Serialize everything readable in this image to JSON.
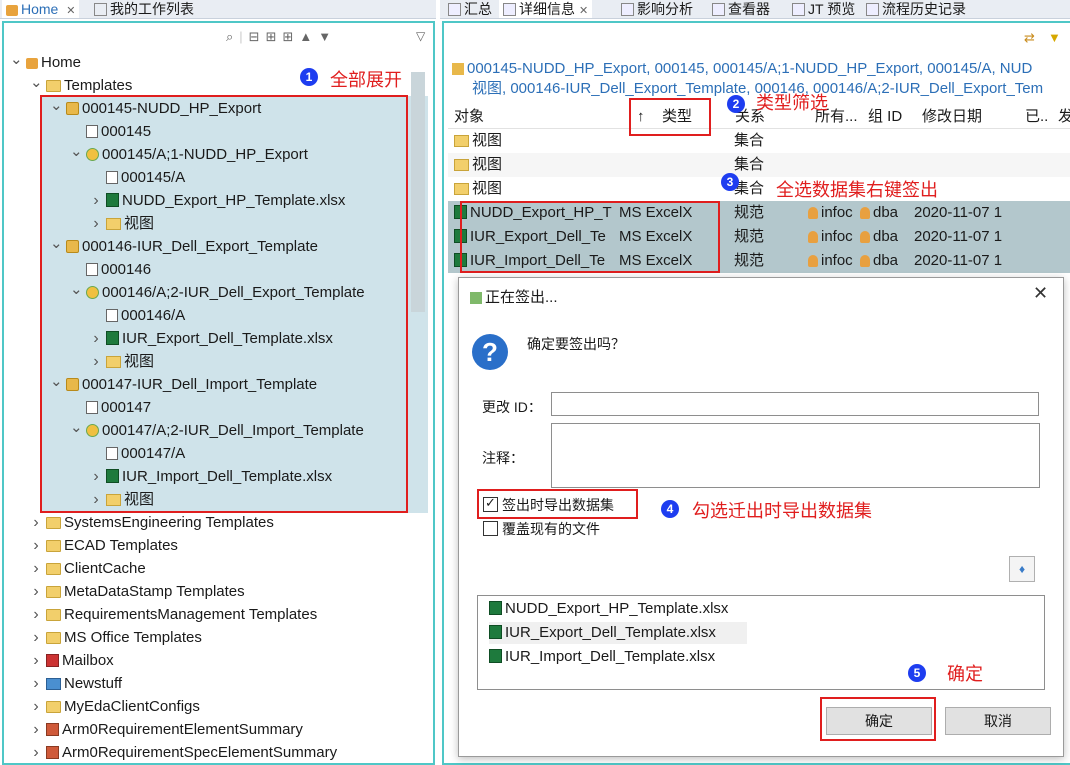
{
  "left_tabs": [
    "Home",
    "我的工作列表"
  ],
  "right_tabs": [
    "汇总",
    "详细信息",
    "影响分析",
    "查看器",
    "JT 预览",
    "流程历史记录"
  ],
  "tree": [
    {
      "label": "Home",
      "level": 0,
      "toggle": "v",
      "icon": "home-icon"
    },
    {
      "label": "Templates",
      "level": 1,
      "toggle": "v",
      "icon": "folder-icon"
    },
    {
      "label": "000145-NUDD_HP_Export",
      "level": 2,
      "toggle": "v",
      "icon": "item-icon"
    },
    {
      "label": "000145",
      "level": 3,
      "toggle": "",
      "icon": "form-icon"
    },
    {
      "label": "000145/A;1-NUDD_HP_Export",
      "level": 3,
      "toggle": "v",
      "icon": "revision-icon"
    },
    {
      "label": "000145/A",
      "level": 4,
      "toggle": "",
      "icon": "form-icon"
    },
    {
      "label": "NUDD_Export_HP_Template.xlsx",
      "level": 4,
      "toggle": ">",
      "icon": "excel-icon"
    },
    {
      "label": "视图",
      "level": 4,
      "toggle": ">",
      "icon": "view-folder-icon"
    },
    {
      "label": "000146-IUR_Dell_Export_Template",
      "level": 2,
      "toggle": "v",
      "icon": "item-icon"
    },
    {
      "label": "000146",
      "level": 3,
      "toggle": "",
      "icon": "form-icon"
    },
    {
      "label": "000146/A;2-IUR_Dell_Export_Template",
      "level": 3,
      "toggle": "v",
      "icon": "revision-icon"
    },
    {
      "label": "000146/A",
      "level": 4,
      "toggle": "",
      "icon": "form-icon"
    },
    {
      "label": "IUR_Export_Dell_Template.xlsx",
      "level": 4,
      "toggle": ">",
      "icon": "excel-icon"
    },
    {
      "label": "视图",
      "level": 4,
      "toggle": ">",
      "icon": "view-folder-icon"
    },
    {
      "label": "000147-IUR_Dell_Import_Template",
      "level": 2,
      "toggle": "v",
      "icon": "item-icon"
    },
    {
      "label": "000147",
      "level": 3,
      "toggle": "",
      "icon": "form-icon"
    },
    {
      "label": "000147/A;2-IUR_Dell_Import_Template",
      "level": 3,
      "toggle": "v",
      "icon": "revision-icon"
    },
    {
      "label": "000147/A",
      "level": 4,
      "toggle": "",
      "icon": "form-icon"
    },
    {
      "label": "IUR_Import_Dell_Template.xlsx",
      "level": 4,
      "toggle": ">",
      "icon": "excel-icon"
    },
    {
      "label": "视图",
      "level": 4,
      "toggle": ">",
      "icon": "view-folder-icon"
    },
    {
      "label": "SystemsEngineering Templates",
      "level": 1,
      "toggle": ">",
      "icon": "folder-icon"
    },
    {
      "label": "ECAD Templates",
      "level": 1,
      "toggle": ">",
      "icon": "folder-icon"
    },
    {
      "label": "ClientCache",
      "level": 1,
      "toggle": ">",
      "icon": "folder-icon"
    },
    {
      "label": "MetaDataStamp Templates",
      "level": 1,
      "toggle": ">",
      "icon": "folder-icon"
    },
    {
      "label": "RequirementsManagement Templates",
      "level": 1,
      "toggle": ">",
      "icon": "folder-icon"
    },
    {
      "label": "MS Office Templates",
      "level": 1,
      "toggle": ">",
      "icon": "folder-icon"
    },
    {
      "label": "Mailbox",
      "level": 1,
      "toggle": ">",
      "icon": "mailbox-icon"
    },
    {
      "label": "Newstuff",
      "level": 1,
      "toggle": ">",
      "icon": "newstuff-icon"
    },
    {
      "label": "MyEdaClientConfigs",
      "level": 1,
      "toggle": ">",
      "icon": "folder-icon"
    },
    {
      "label": "Arm0RequirementElementSummary",
      "level": 1,
      "toggle": ">",
      "icon": "table-icon"
    },
    {
      "label": "Arm0RequirementSpecElementSummary",
      "level": 1,
      "toggle": ">",
      "icon": "table-icon"
    }
  ],
  "details": {
    "path_line1": "000145-NUDD_HP_Export, 000145, 000145/A;1-NUDD_HP_Export, 000145/A, NUD",
    "path_line2": "视图, 000146-IUR_Dell_Export_Template, 000146, 000146/A;2-IUR_Dell_Export_Tem",
    "columns": [
      "对象",
      "类型",
      "关系",
      "所有...",
      "组 ID",
      "修改日期",
      "已..",
      "发"
    ],
    "rows": [
      {
        "object": "视图",
        "type": "",
        "relation": "集合",
        "owner": "",
        "group": "",
        "date": "",
        "icon": "view-folder-icon",
        "selected": false
      },
      {
        "object": "视图",
        "type": "",
        "relation": "集合",
        "owner": "",
        "group": "",
        "date": "",
        "icon": "view-folder-icon",
        "selected": false
      },
      {
        "object": "视图",
        "type": "",
        "relation": "集合",
        "owner": "",
        "group": "",
        "date": "",
        "icon": "view-folder-icon",
        "selected": false
      },
      {
        "object": "NUDD_Export_HP_T",
        "type": "MS ExcelX",
        "relation": "规范",
        "owner": "infoc",
        "group": "dba",
        "date": "2020-11-07 1",
        "icon": "excel-icon",
        "selected": true
      },
      {
        "object": "IUR_Export_Dell_Te",
        "type": "MS ExcelX",
        "relation": "规范",
        "owner": "infoc",
        "group": "dba",
        "date": "2020-11-07 1",
        "icon": "excel-icon",
        "selected": true
      },
      {
        "object": "IUR_Import_Dell_Te",
        "type": "MS ExcelX",
        "relation": "规范",
        "owner": "infoc",
        "group": "dba",
        "date": "2020-11-07 1",
        "icon": "excel-icon",
        "selected": true
      }
    ]
  },
  "dialog": {
    "title": "正在签出...",
    "question": "确定要签出吗？",
    "change_id_label": "更改 ID：",
    "change_id_value": "",
    "comment_label": "注释：",
    "export_checkbox_label": "签出时导出数据集",
    "export_checked": true,
    "overwrite_checkbox_label": "覆盖现有的文件",
    "overwrite_checked": false,
    "files": [
      "NUDD_Export_HP_Template.xlsx",
      "IUR_Export_Dell_Template.xlsx",
      "IUR_Import_Dell_Template.xlsx"
    ],
    "ok_label": "确定",
    "cancel_label": "取消"
  },
  "annotations": [
    {
      "num": "1",
      "text": "全部展开"
    },
    {
      "num": "2",
      "text": "类型筛选"
    },
    {
      "num": "3",
      "text": "全选数据集右键签出"
    },
    {
      "num": "4",
      "text": "勾选迁出时导出数据集"
    },
    {
      "num": "5",
      "text": "确定"
    }
  ],
  "colors": {
    "accent_border": "#4fc7c7",
    "annotation_red": "#e01e1e",
    "annotation_blue": "#1e3df0",
    "selection": "#cfe3ea",
    "selected_row": "#b3c7cc"
  }
}
